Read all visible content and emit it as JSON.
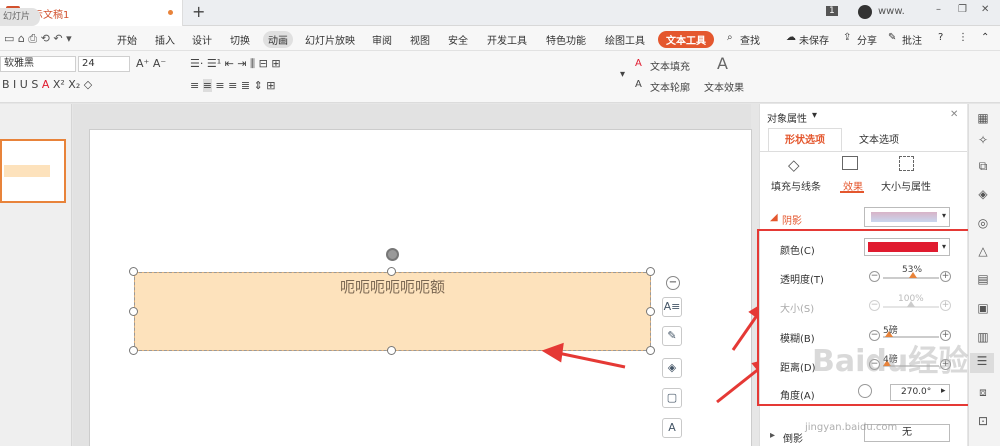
{
  "titlebar": {
    "doc_tab": "演示文稿1",
    "ppt_badge": "P",
    "page_badge": "1",
    "user": "www.",
    "win_min": "–",
    "win_restore": "❐",
    "win_close": "✕"
  },
  "menu": {
    "items": [
      "开始",
      "插入",
      "设计",
      "切换",
      "动画",
      "幻灯片放映",
      "审阅",
      "视图",
      "安全",
      "开发工具",
      "特色功能",
      "绘图工具",
      "文本工具"
    ],
    "search": "查找",
    "unsaved": "未保存",
    "share": "分享",
    "comment": "批注",
    "help": "?"
  },
  "ribbon": {
    "font_name": "软雅黑",
    "font_size": "24",
    "text_fill": "文本填充",
    "text_outline": "文本轮廓",
    "text_effect": "文本效果",
    "style_letter": "A",
    "style_colors": [
      "#111111",
      "#4a8fe0",
      "#4a8fe0",
      "#f0a0a0",
      "#f5a623",
      "#888888"
    ]
  },
  "left": {
    "tab": "幻灯片"
  },
  "slide": {
    "shape_text": "呃呃呃呃呃呃额",
    "shape_fill": "#fde2bc"
  },
  "props": {
    "title": "对象属性",
    "close": "✕",
    "tab_shape": "形状选项",
    "tab_text": "文本选项",
    "sub_fill": "填充与线条",
    "sub_effect": "效果",
    "sub_size": "大小与属性",
    "shadow_section": "阴影",
    "rows": {
      "color": {
        "label": "颜色(C)",
        "value_color": "#e01b2f"
      },
      "transparency": {
        "label": "透明度(T)",
        "value": "53%",
        "level": 0.53
      },
      "size": {
        "label": "大小(S)",
        "value": "100%",
        "level": 0.5
      },
      "blur": {
        "label": "模糊(B)",
        "value": "5磅",
        "level": 0.1
      },
      "distance": {
        "label": "距离(D)",
        "value": "4磅",
        "level": 0.08
      },
      "angle": {
        "label": "角度(A)",
        "value": "270.0°"
      }
    },
    "reflection_section": "倒影",
    "reflection_value": "无"
  },
  "watermark": {
    "text": "Baidu经验",
    "url": "jingyan.baidu.com"
  },
  "colors": {
    "accent": "#e8833a",
    "tool_tab": "#e4572e",
    "annotation": "#e53935"
  }
}
